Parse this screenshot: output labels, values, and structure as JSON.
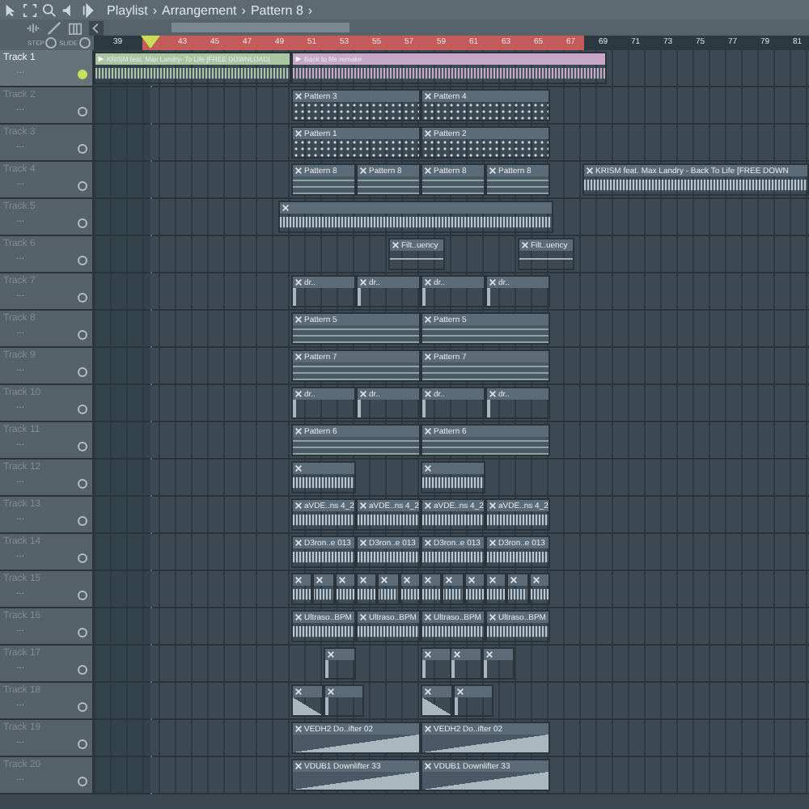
{
  "toolbar": {
    "breadcrumb": [
      "Playlist",
      "Arrangement",
      "Pattern 8"
    ],
    "separator": "›"
  },
  "snap": {
    "step_label": "STEP",
    "slide_label": "SLIDE"
  },
  "ruler": {
    "labels": [
      "39",
      "43",
      "45",
      "47",
      "49",
      "51",
      "53",
      "55",
      "57",
      "59",
      "61",
      "63",
      "65",
      "67",
      "69",
      "71",
      "73",
      "75",
      "77",
      "79",
      "81"
    ]
  },
  "tracks": [
    {
      "name": "Track 1",
      "menu": "...",
      "active": true,
      "clips": [
        {
          "label": "KRISM feat. Max Landry- To Life [FREE DOWNLOAD]",
          "kind": "audio",
          "color": "#a9c6a1"
        },
        {
          "label": "Back to life remake",
          "kind": "audio",
          "color": "#c8a8c8"
        }
      ]
    },
    {
      "name": "Track 2",
      "menu": "...",
      "active": false,
      "clips": [
        {
          "label": "Pattern 3",
          "kind": "pattern",
          "color": "#5b6b78"
        },
        {
          "label": "Pattern 4",
          "kind": "pattern",
          "color": "#5b6b78"
        }
      ]
    },
    {
      "name": "Track 3",
      "menu": "...",
      "active": false,
      "clips": [
        {
          "label": "Pattern 1",
          "kind": "pattern",
          "color": "#5b6b78"
        },
        {
          "label": "Pattern 2",
          "kind": "pattern",
          "color": "#5b6b78"
        }
      ]
    },
    {
      "name": "Track 4",
      "menu": "...",
      "active": false,
      "clips": [
        {
          "label": "Pattern 8",
          "kind": "bars",
          "color": "#5b6b78"
        },
        {
          "label": "Pattern 8",
          "kind": "bars",
          "color": "#5b6b78"
        },
        {
          "label": "Pattern 8",
          "kind": "bars",
          "color": "#5b6b78"
        },
        {
          "label": "Pattern 8",
          "kind": "bars",
          "color": "#5b6b78"
        },
        {
          "label": "KRISM feat. Max Landry - Back To Life [FREE DOWN",
          "kind": "audio",
          "color": "#5b6b78"
        }
      ]
    },
    {
      "name": "Track 5",
      "menu": "...",
      "active": false,
      "clips": [
        {
          "kind": "audio",
          "color": "#5b6b78"
        }
      ]
    },
    {
      "name": "Track 6",
      "menu": "...",
      "active": false,
      "clips": [
        {
          "label": "Filt..uency",
          "kind": "automation",
          "color": "#5b6b78"
        },
        {
          "label": "Filt..uency",
          "kind": "automation",
          "color": "#5b6b78"
        }
      ]
    },
    {
      "name": "Track 7",
      "menu": "...",
      "active": false,
      "clips": [
        {
          "label": "dr..",
          "kind": "hit",
          "color": "#5b6b78"
        },
        {
          "label": "dr..",
          "kind": "hit",
          "color": "#5b6b78"
        },
        {
          "label": "dr..",
          "kind": "hit",
          "color": "#5b6b78"
        },
        {
          "label": "dr..",
          "kind": "hit",
          "color": "#5b6b78"
        }
      ]
    },
    {
      "name": "Track 8",
      "menu": "...",
      "active": false,
      "clips": [
        {
          "label": "Pattern 5",
          "kind": "bars",
          "color": "#5b6b78"
        },
        {
          "label": "Pattern 5",
          "kind": "bars",
          "color": "#5b6b78"
        }
      ]
    },
    {
      "name": "Track 9",
      "menu": "...",
      "active": false,
      "clips": [
        {
          "label": "Pattern 7",
          "kind": "bars",
          "color": "#5b6b78"
        },
        {
          "label": "Pattern 7",
          "kind": "bars",
          "color": "#5b6b78"
        }
      ]
    },
    {
      "name": "Track 10",
      "menu": "...",
      "active": false,
      "clips": [
        {
          "label": "dr..",
          "kind": "hit",
          "color": "#5b6b78"
        },
        {
          "label": "dr..",
          "kind": "hit",
          "color": "#5b6b78"
        },
        {
          "label": "dr..",
          "kind": "hit",
          "color": "#5b6b78"
        },
        {
          "label": "dr..",
          "kind": "hit",
          "color": "#5b6b78"
        }
      ]
    },
    {
      "name": "Track 11",
      "menu": "...",
      "active": false,
      "clips": [
        {
          "label": "Pattern 6",
          "kind": "bars",
          "color": "#5b6b78"
        },
        {
          "label": "Pattern 6",
          "kind": "bars",
          "color": "#5b6b78"
        }
      ]
    },
    {
      "name": "Track 12",
      "menu": "...",
      "active": false,
      "clips": [
        {
          "kind": "audio",
          "color": "#5b6b78"
        },
        {
          "kind": "audio",
          "color": "#5b6b78"
        }
      ]
    },
    {
      "name": "Track 13",
      "menu": "...",
      "active": false,
      "clips": [
        {
          "label": "aVDE..ns 4_2",
          "kind": "audio",
          "color": "#5b6b78"
        },
        {
          "label": "aVDE..ns 4_2",
          "kind": "audio",
          "color": "#5b6b78"
        },
        {
          "label": "aVDE..ns 4_2",
          "kind": "audio",
          "color": "#5b6b78"
        },
        {
          "label": "aVDE..ns 4_2",
          "kind": "audio",
          "color": "#5b6b78"
        }
      ]
    },
    {
      "name": "Track 14",
      "menu": "...",
      "active": false,
      "clips": [
        {
          "label": "D3ron..e 013",
          "kind": "audio",
          "color": "#5b6b78"
        },
        {
          "label": "D3ron..e 013",
          "kind": "audio",
          "color": "#5b6b78"
        },
        {
          "label": "D3ron..e 013",
          "kind": "audio",
          "color": "#5b6b78"
        },
        {
          "label": "D3ron..e 013",
          "kind": "audio",
          "color": "#5b6b78"
        }
      ]
    },
    {
      "name": "Track 15",
      "menu": "...",
      "active": false,
      "clips": [
        {
          "kind": "audio",
          "color": "#5b6b78"
        },
        {
          "kind": "audio",
          "color": "#5b6b78"
        },
        {
          "kind": "audio",
          "color": "#5b6b78"
        },
        {
          "kind": "audio",
          "color": "#5b6b78"
        },
        {
          "kind": "audio",
          "color": "#5b6b78"
        },
        {
          "kind": "audio",
          "color": "#5b6b78"
        },
        {
          "kind": "audio",
          "color": "#5b6b78"
        },
        {
          "kind": "audio",
          "color": "#5b6b78"
        },
        {
          "kind": "audio",
          "color": "#5b6b78"
        },
        {
          "kind": "audio",
          "color": "#5b6b78"
        },
        {
          "kind": "audio",
          "color": "#5b6b78"
        },
        {
          "kind": "audio",
          "color": "#5b6b78"
        }
      ]
    },
    {
      "name": "Track 16",
      "menu": "...",
      "active": false,
      "clips": [
        {
          "label": "Ultraso..BPM",
          "kind": "audio",
          "color": "#5b6b78"
        },
        {
          "label": "Ultraso..BPM",
          "kind": "audio",
          "color": "#5b6b78"
        },
        {
          "label": "Ultraso..BPM",
          "kind": "audio",
          "color": "#5b6b78"
        },
        {
          "label": "Ultraso..BPM",
          "kind": "audio",
          "color": "#5b6b78"
        }
      ]
    },
    {
      "name": "Track 17",
      "menu": "...",
      "active": false,
      "clips": [
        {
          "kind": "hit",
          "color": "#5b6b78"
        },
        {
          "kind": "hit",
          "color": "#5b6b78"
        },
        {
          "kind": "hit",
          "color": "#5b6b78"
        },
        {
          "kind": "hit",
          "color": "#5b6b78"
        }
      ]
    },
    {
      "name": "Track 18",
      "menu": "...",
      "active": false,
      "clips": [
        {
          "kind": "rise",
          "color": "#5b6b78"
        },
        {
          "kind": "hit",
          "color": "#5b6b78"
        },
        {
          "kind": "rise",
          "color": "#5b6b78"
        },
        {
          "kind": "hit",
          "color": "#5b6b78"
        }
      ]
    },
    {
      "name": "Track 19",
      "menu": "...",
      "active": false,
      "clips": [
        {
          "label": "VEDH2 Do..ifter 02",
          "kind": "fall",
          "color": "#5b6b78"
        },
        {
          "label": "VEDH2 Do..ifter 02",
          "kind": "fall",
          "color": "#5b6b78"
        }
      ]
    },
    {
      "name": "Track 20",
      "menu": "...",
      "active": false,
      "clips": [
        {
          "label": "VDUB1 Downlifter 33",
          "kind": "fall",
          "color": "#5b6b78"
        },
        {
          "label": "VDUB1 Downlifter 33",
          "kind": "fall",
          "color": "#5b6b78"
        }
      ]
    }
  ]
}
